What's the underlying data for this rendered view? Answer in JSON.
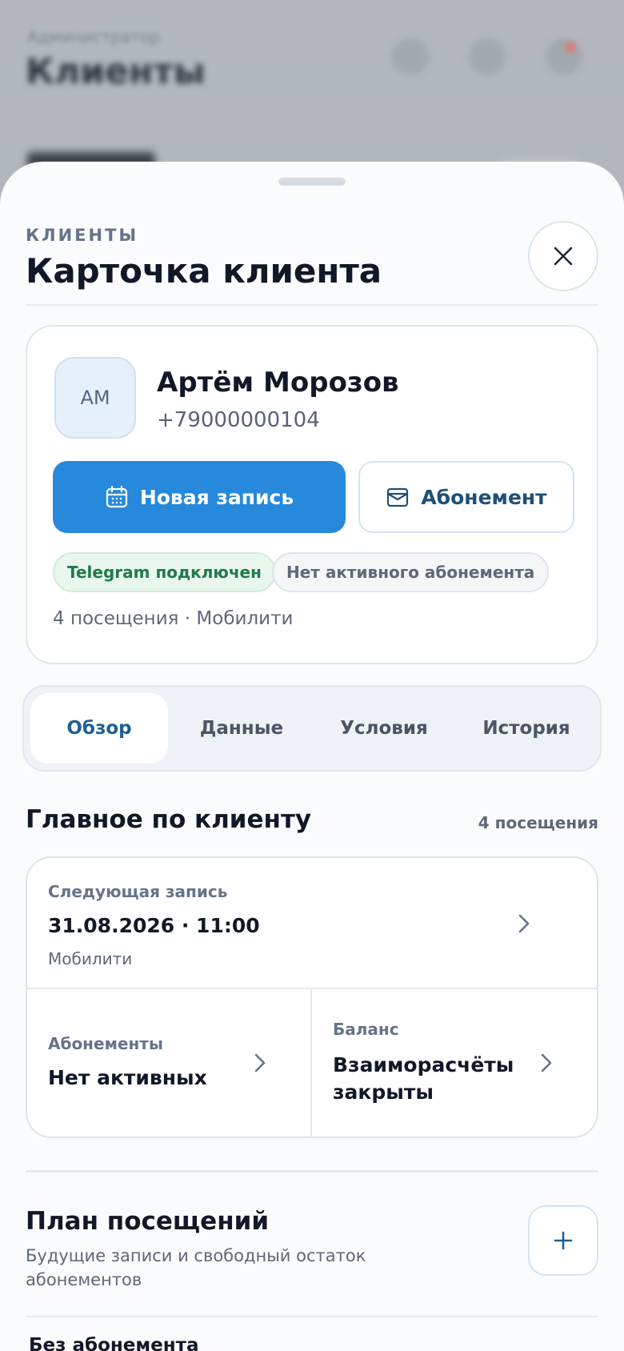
{
  "background": {
    "subtitle": "Администратор",
    "title": "Клиенты"
  },
  "sheet": {
    "eyebrow": "КЛИЕНТЫ",
    "title": "Карточка клиента"
  },
  "client": {
    "initials": "АМ",
    "name": "Артём Морозов",
    "phone": "+79000000104",
    "new_booking_label": "Новая запись",
    "subscription_label": "Абонемент",
    "chip_telegram": "Telegram подключен",
    "chip_subscription": "Нет активного абонемента",
    "meta": "4 посещения · Мобилити"
  },
  "tabs": [
    {
      "label": "Обзор",
      "active": true
    },
    {
      "label": "Данные",
      "active": false
    },
    {
      "label": "Условия",
      "active": false
    },
    {
      "label": "История",
      "active": false
    }
  ],
  "summary": {
    "title": "Главное по клиенту",
    "count": "4 посещения",
    "next_label": "Следующая запись",
    "next_value": "31.08.2026 · 11:00",
    "next_sub": "Мобилити",
    "subs_label": "Абонементы",
    "subs_value": "Нет активных",
    "balance_label": "Баланс",
    "balance_value": "Взаиморасчёты закрыты"
  },
  "plan": {
    "title": "План посещений",
    "description": "Будущие записи и свободный остаток абонементов",
    "group_title": "Без абонемента"
  },
  "colors": {
    "accent": "#2689dc",
    "success": "#1f7a4a",
    "text": "#111827"
  }
}
